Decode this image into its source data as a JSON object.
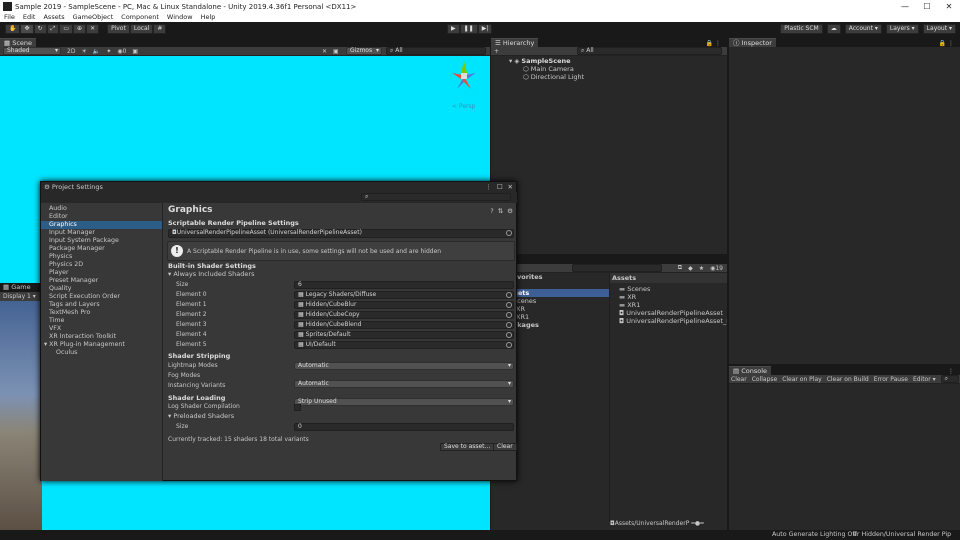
{
  "window": {
    "title": "Sample 2019 - SampleScene - PC, Mac & Linux Standalone - Unity 2019.4.36f1 Personal <DX11>",
    "min": "—",
    "max": "☐",
    "close": "✕"
  },
  "menu": [
    "File",
    "Edit",
    "Assets",
    "GameObject",
    "Component",
    "Window",
    "Help"
  ],
  "toolbar": {
    "pivot": "Pivot",
    "local": "Local",
    "plastic": "Plastic SCM",
    "account": "Account",
    "layers": "Layers",
    "layout": "Layout"
  },
  "scene": {
    "tab": "Scene",
    "shading": "Shaded",
    "mode2d": "2D",
    "gizmos": "Gizmos",
    "search_placeholder": "All",
    "persp": "< Persp",
    "bg": "#00e5ff"
  },
  "game": {
    "tab": "Game",
    "display": "Display 1"
  },
  "hierarchy": {
    "tab": "Hierarchy",
    "add": "+",
    "search_placeholder": "All",
    "scene": "SampleScene",
    "items": [
      "Main Camera",
      "Directional Light"
    ]
  },
  "inspector": {
    "tab": "Inspector"
  },
  "project": {
    "tab": "oject",
    "count": "19",
    "favorites_label": "vorites",
    "tree": [
      "sets",
      "Scenes",
      "XR",
      "XR1",
      "ackages"
    ],
    "assets_title": "Assets",
    "assets": [
      "Scenes",
      "XR",
      "XR1",
      "UniversalRenderPipelineAsset",
      "UniversalRenderPipelineAsset_Re"
    ],
    "path": "Assets/UniversalRenderP"
  },
  "console": {
    "tab": "Console",
    "buttons": [
      "Clear",
      "Collapse",
      "Clear on Play",
      "Clear on Build",
      "Error Pause",
      "Editor ▾"
    ]
  },
  "status": {
    "left": "Auto Generate Lighting Off",
    "right": "er Hidden/Universal Render Pip"
  },
  "project_settings": {
    "title": "Project Settings",
    "sidebar": [
      "Audio",
      "Editor",
      "Graphics",
      "Input Manager",
      "Input System Package",
      "Package Manager",
      "Physics",
      "Physics 2D",
      "Player",
      "Preset Manager",
      "Quality",
      "Script Execution Order",
      "Tags and Layers",
      "TextMesh Pro",
      "Time",
      "VFX",
      "XR Interaction Toolkit",
      "XR Plug-in Management",
      "Oculus"
    ],
    "selected": "Graphics",
    "heading": "Graphics",
    "srp_label": "Scriptable Render Pipeline Settings",
    "srp_value": "UniversalRenderPipelineAsset (UniversalRenderPipelineAsset)",
    "warning": "A Scriptable Render Pipeline is in use, some settings will not be used and are hidden",
    "builtin_label": "Built-in Shader Settings",
    "always_label": "Always Included Shaders",
    "size_label": "Size",
    "size_value": "6",
    "elements": [
      {
        "label": "Element 0",
        "value": "Legacy Shaders/Diffuse"
      },
      {
        "label": "Element 1",
        "value": "Hidden/CubeBlur"
      },
      {
        "label": "Element 2",
        "value": "Hidden/CubeCopy"
      },
      {
        "label": "Element 3",
        "value": "Hidden/CubeBlend"
      },
      {
        "label": "Element 4",
        "value": "Sprites/Default"
      },
      {
        "label": "Element 5",
        "value": "UI/Default"
      }
    ],
    "stripping_label": "Shader Stripping",
    "lightmap_label": "Lightmap Modes",
    "lightmap_value": "Automatic",
    "fog_label": "Fog Modes",
    "fog_value": "Automatic",
    "instancing_label": "Instancing Variants",
    "instancing_value": "Strip Unused",
    "loading_label": "Shader Loading",
    "log_label": "Log Shader Compilation",
    "preloaded_label": "Preloaded Shaders",
    "pre_size_label": "Size",
    "pre_size_value": "0",
    "tracked": "Currently tracked: 15 shaders 18 total variants",
    "save_btn": "Save to asset...",
    "clear_btn": "Clear"
  }
}
